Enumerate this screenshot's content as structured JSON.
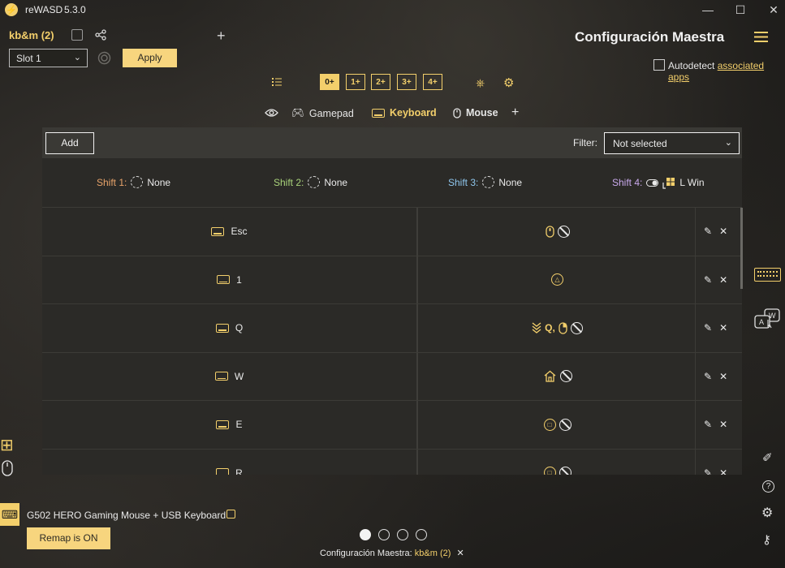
{
  "app": {
    "logo_glyph": "⚡",
    "title": "reWASD",
    "version": "5.3.0"
  },
  "window": {
    "minimize": "—",
    "maximize": "☐",
    "close": "✕"
  },
  "header": {
    "config_name": "kb&m (2)",
    "slot": "Slot 1",
    "apply_label": "Apply",
    "page_title": "Configuración Maestra",
    "autodetect_label": "Autodetect",
    "autodetect_link": "associated apps"
  },
  "layers": [
    "0",
    "1",
    "2",
    "3",
    "4"
  ],
  "tabs": {
    "gamepad": "Gamepad",
    "keyboard": "Keyboard",
    "mouse": "Mouse"
  },
  "toolbar": {
    "add_label": "Add",
    "filter_label": "Filter:",
    "filter_value": "Not selected"
  },
  "shifts": [
    {
      "label": "Shift 1:",
      "value": "None",
      "color": "#e8a36a"
    },
    {
      "label": "Shift 2:",
      "value": "None",
      "color": "#a9d37a"
    },
    {
      "label": "Shift 3:",
      "value": "None",
      "color": "#8fc7ee"
    },
    {
      "label": "Shift 4:",
      "value": "L Win",
      "color": "#c9a9ec"
    }
  ],
  "mappings": [
    {
      "key": "Esc",
      "mapping_text": ""
    },
    {
      "key": "1",
      "mapping_text": ""
    },
    {
      "key": "Q",
      "mapping_text": "Q,"
    },
    {
      "key": "W",
      "mapping_text": ""
    },
    {
      "key": "E",
      "mapping_text": ""
    },
    {
      "key": "R",
      "mapping_text": ""
    }
  ],
  "bottom": {
    "device_name": "G502 HERO Gaming Mouse + USB Keyboard",
    "remap_label": "Remap is ON",
    "status_prefix": "Configuración Maestra:",
    "status_config": "kb&m (2)"
  },
  "colors": {
    "accent": "#f3cf6b",
    "panel": "#2b2a27",
    "panel_header": "#3a3935"
  }
}
